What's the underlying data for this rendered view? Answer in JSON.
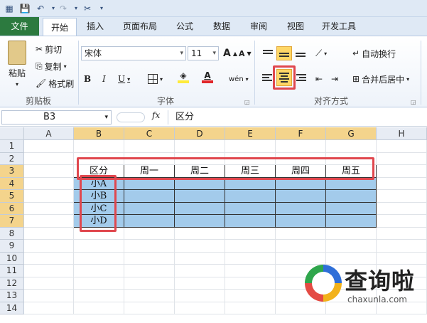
{
  "qat": {
    "save": "💾",
    "undo": "↶",
    "redo": "↷",
    "tool": "✂",
    "more": "▾"
  },
  "tabs": [
    "文件",
    "开始",
    "插入",
    "页面布局",
    "公式",
    "数据",
    "审阅",
    "视图",
    "开发工具"
  ],
  "clipboard": {
    "paste": "粘贴",
    "cut": "剪切",
    "copy": "复制",
    "format_painter": "格式刷",
    "group": "剪贴板"
  },
  "font": {
    "name": "宋体",
    "size": "11",
    "group": "字体",
    "bold": "B",
    "italic": "I",
    "underline": "U",
    "grow": "A",
    "shrink": "A",
    "wen": "wén"
  },
  "alignment": {
    "wrap": "自动换行",
    "merge": "合并后居中",
    "group": "对齐方式"
  },
  "formula_bar": {
    "name_box": "B3",
    "fx": "fx",
    "content": "区分"
  },
  "columns": [
    "A",
    "B",
    "C",
    "D",
    "E",
    "F",
    "G",
    "H"
  ],
  "rows": [
    "1",
    "2",
    "3",
    "4",
    "5",
    "6",
    "7",
    "8",
    "9",
    "10",
    "11",
    "12",
    "13",
    "14"
  ],
  "table": {
    "header": [
      "区分",
      "周一",
      "周二",
      "周三",
      "周四",
      "周五"
    ],
    "row_labels": [
      "小A",
      "小B",
      "小C",
      "小D"
    ]
  },
  "watermark": {
    "title": "查询啦",
    "url": "chaxunla.com"
  },
  "colors": {
    "file_tab": "#2c7a3f",
    "fill": "#a3cbeb",
    "highlight": "#e0474e",
    "selected_header": "#f4d48c"
  }
}
